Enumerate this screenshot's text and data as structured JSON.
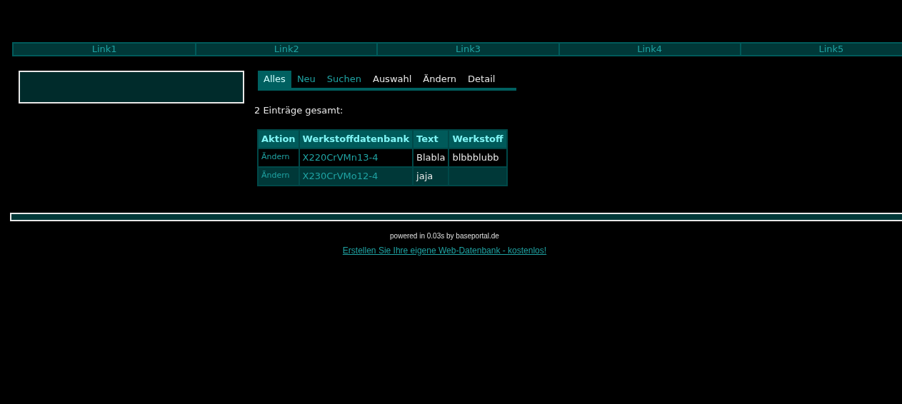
{
  "nav": [
    {
      "label": "Link1"
    },
    {
      "label": "Link2"
    },
    {
      "label": "Link3"
    },
    {
      "label": "Link4"
    },
    {
      "label": "Link5"
    }
  ],
  "tabs": [
    {
      "label": "Alles",
      "selected": true,
      "kind": "link"
    },
    {
      "label": "Neu",
      "selected": false,
      "kind": "link"
    },
    {
      "label": "Suchen",
      "selected": false,
      "kind": "link"
    },
    {
      "label": "Auswahl",
      "selected": false,
      "kind": "plain"
    },
    {
      "label": "Ändern",
      "selected": false,
      "kind": "plain"
    },
    {
      "label": "Detail",
      "selected": false,
      "kind": "plain"
    }
  ],
  "count_text": "2 Einträge gesamt:",
  "table": {
    "columns": [
      "Aktion",
      "Werkstoffdatenbank",
      "Text",
      "Werkstoff"
    ],
    "rows": [
      {
        "cells": [
          {
            "text": "Ändern",
            "kind": "action"
          },
          {
            "text": "X220CrVMn13-4",
            "kind": "link"
          },
          {
            "text": "Blabla",
            "kind": "text"
          },
          {
            "text": "blbbblubb",
            "kind": "text"
          }
        ]
      },
      {
        "cells": [
          {
            "text": "Ändern",
            "kind": "action"
          },
          {
            "text": "X230CrVMo12-4",
            "kind": "link"
          },
          {
            "text": "jaja",
            "kind": "text"
          }
        ]
      }
    ]
  },
  "footer": {
    "powered": "powered in 0.03s by baseportal.de",
    "link": "Erstellen Sie Ihre eigene Web-Datenbank - kostenlos!"
  }
}
